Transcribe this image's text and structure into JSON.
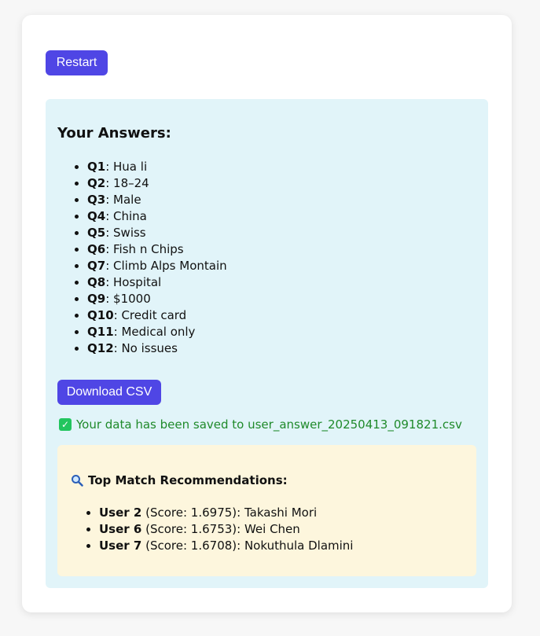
{
  "restart_label": "Restart",
  "answers": {
    "title": "Your Answers:",
    "items": [
      {
        "q": "Q1",
        "a": ": Hua li"
      },
      {
        "q": "Q2",
        "a": ": 18–24"
      },
      {
        "q": "Q3",
        "a": ": Male"
      },
      {
        "q": "Q4",
        "a": ": China"
      },
      {
        "q": "Q5",
        "a": ": Swiss"
      },
      {
        "q": "Q6",
        "a": ": Fish n Chips"
      },
      {
        "q": "Q7",
        "a": ": Climb Alps Montain"
      },
      {
        "q": "Q8",
        "a": ": Hospital"
      },
      {
        "q": "Q9",
        "a": ": $1000"
      },
      {
        "q": "Q10",
        "a": ": Credit card"
      },
      {
        "q": "Q11",
        "a": ": Medical only"
      },
      {
        "q": "Q12",
        "a": ": No issues"
      }
    ]
  },
  "download_label": "Download CSV",
  "saved_message": "Your data has been saved to user_answer_20250413_091821.csv",
  "recommendations": {
    "title": "Top Match Recommendations:",
    "items": [
      {
        "user": "User 2",
        "detail": " (Score: 1.6975): Takashi Mori"
      },
      {
        "user": "User 6",
        "detail": " (Score: 1.6753): Wei Chen"
      },
      {
        "user": "User 7",
        "detail": " (Score: 1.6708): Nokuthula Dlamini"
      }
    ]
  },
  "icons": {
    "saved": "check-icon",
    "recommendations": "magnifier-icon"
  },
  "colors": {
    "accent": "#4f46e5",
    "answers_panel": "#e1f4f9",
    "recommendations_panel": "#fdf6dd",
    "success_text": "#1f8a2a"
  }
}
